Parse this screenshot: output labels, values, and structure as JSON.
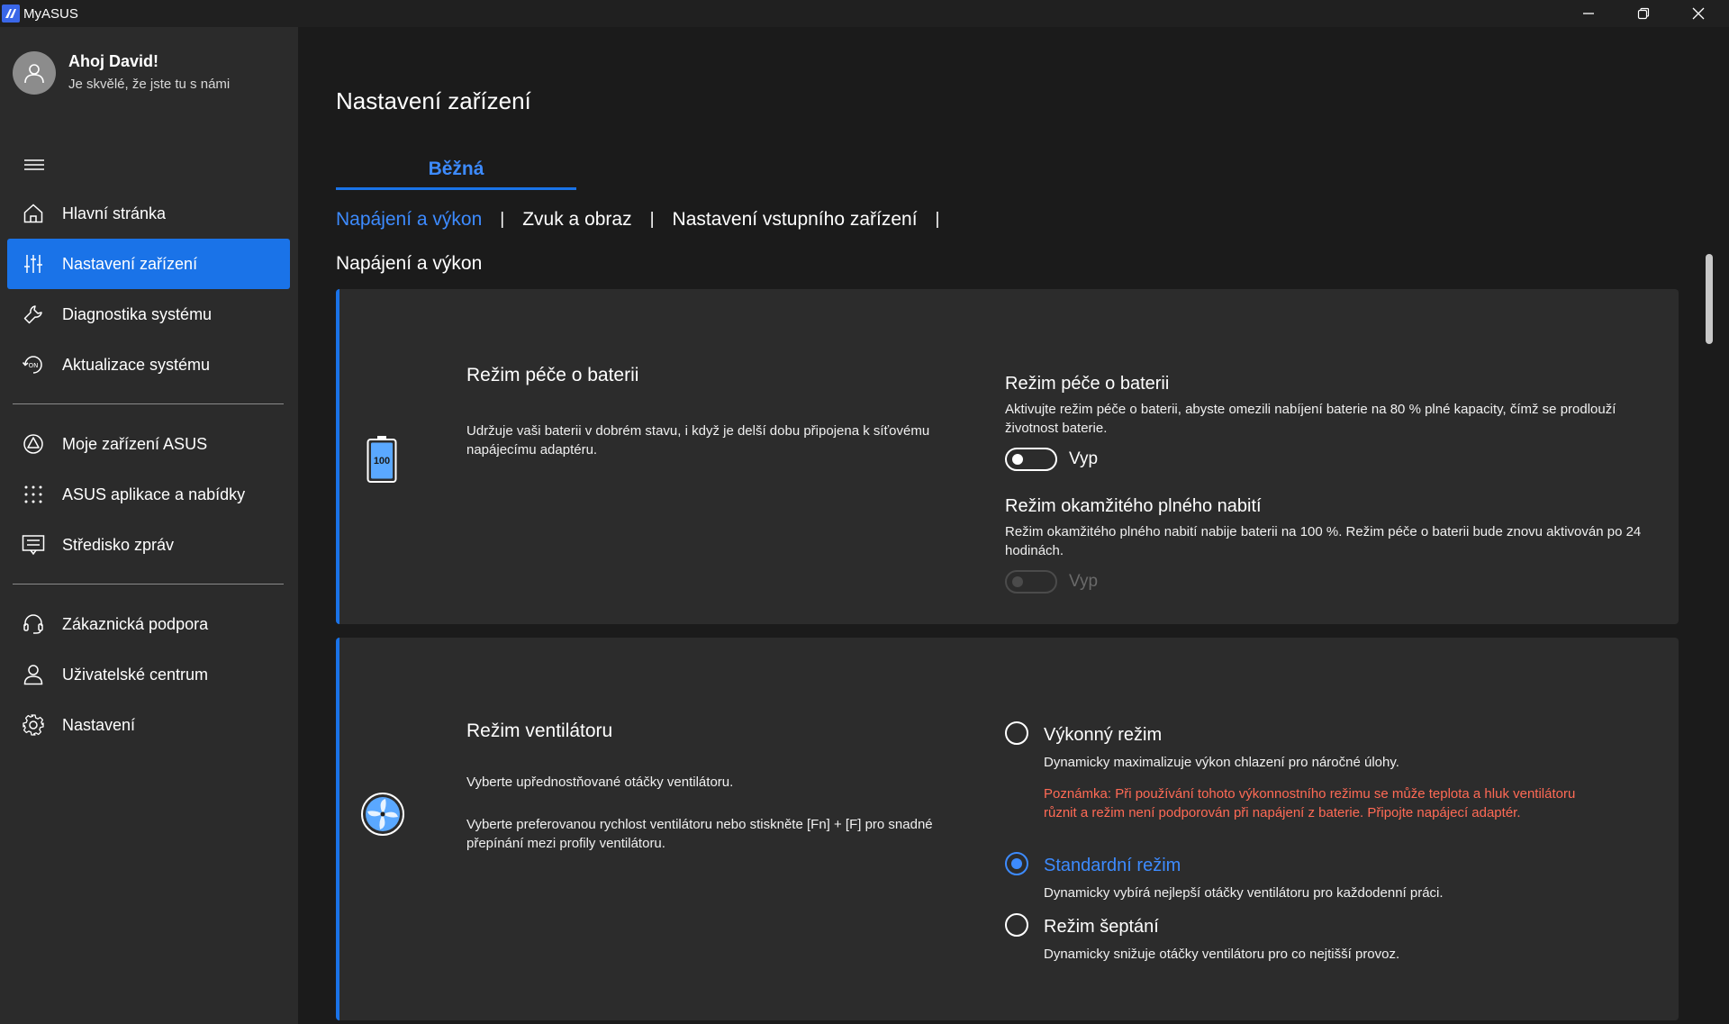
{
  "window": {
    "title": "MyASUS",
    "controls": [
      "minimize",
      "restore",
      "close"
    ]
  },
  "user": {
    "greeting": "Ahoj David!",
    "subtitle": "Je skvělé, že jste tu s námi"
  },
  "sidebar": {
    "items": [
      {
        "label": "Hlavní stránka",
        "icon": "home-icon",
        "active": false
      },
      {
        "label": "Nastavení zařízení",
        "icon": "sliders-icon",
        "active": true
      },
      {
        "label": "Diagnostika systému",
        "icon": "wrench-icon",
        "active": false
      },
      {
        "label": "Aktualizace systému",
        "icon": "update-icon",
        "active": false
      },
      {
        "label": "Moje zařízení ASUS",
        "icon": "asus-device-icon",
        "active": false
      },
      {
        "label": "ASUS aplikace a nabídky",
        "icon": "apps-grid-icon",
        "active": false
      },
      {
        "label": "Středisko zpráv",
        "icon": "message-icon",
        "active": false
      },
      {
        "label": "Zákaznická podpora",
        "icon": "headset-icon",
        "active": false
      },
      {
        "label": "Uživatelské centrum",
        "icon": "user-icon",
        "active": false
      },
      {
        "label": "Nastavení",
        "icon": "gear-icon",
        "active": false
      }
    ]
  },
  "main": {
    "page_title": "Nastavení zařízení",
    "tab": "Běžná",
    "subtabs": [
      "Napájení a výkon",
      "Zvuk a obraz",
      "Nastavení vstupního zařízení"
    ],
    "active_subtab": "Napájení a výkon",
    "section_title": "Napájení a výkon",
    "battery_card": {
      "icon_text": "100",
      "title": "Režim péče o baterii",
      "desc": "Udržuje vaši baterii v dobrém stavu, i když je delší dobu připojena k síťovému napájecímu adaptéru.",
      "care_mode": {
        "title": "Režim péče o baterii",
        "desc": "Aktivujte režim péče o baterii, abyste omezili nabíjení baterie na 80 % plné kapacity, čímž se prodlouží životnost baterie.",
        "toggle_label": "Vyp"
      },
      "instant_full": {
        "title": "Režim okamžitého plného nabití",
        "desc": "Režim okamžitého plného nabití nabije baterii na 100 %. Režim péče o baterii bude znovu aktivován po 24 hodinách.",
        "toggle_label": "Vyp"
      }
    },
    "fan_card": {
      "title": "Režim ventilátoru",
      "desc1": "Vyberte upřednostňované otáčky ventilátoru.",
      "desc2": "Vyberte preferovanou rychlost ventilátoru nebo stiskněte [Fn] + [F] pro snadné přepínání mezi profily ventilátoru.",
      "options": [
        {
          "title": "Výkonný režim",
          "desc": "Dynamicky maximalizuje výkon chlazení pro náročné úlohy.",
          "warning": "Poznámka: Při používání tohoto výkonnostního režimu se může teplota a hluk ventilátoru různit a režim není podporován při napájení z baterie. Připojte napájecí adaptér."
        },
        {
          "title": "Standardní režim",
          "desc": "Dynamicky vybírá nejlepší otáčky ventilátoru pro každodenní práci."
        },
        {
          "title": "Režim šeptání",
          "desc": "Dynamicky snižuje otáčky ventilátoru pro co nejtišší provoz."
        }
      ],
      "selected": "Standardní režim"
    }
  },
  "colors": {
    "accent": "#1a73e8",
    "accent_text": "#3d8bff",
    "warning": "#ff6a55",
    "sidebar_bg": "#2b2b2b",
    "main_bg": "#1b1b1b",
    "card_bg": "#2c2c2c"
  }
}
